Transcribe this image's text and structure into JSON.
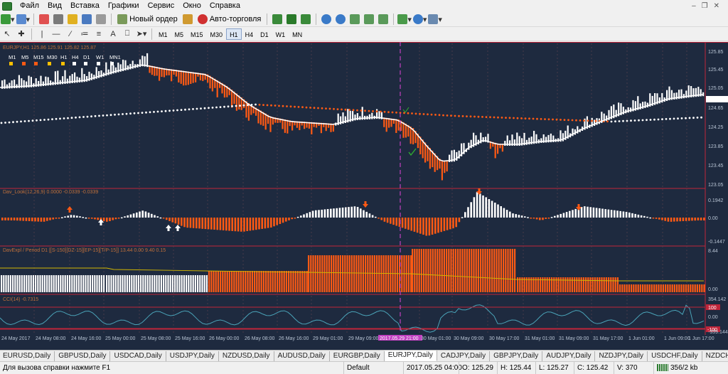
{
  "menu": [
    "Файл",
    "Вид",
    "Вставка",
    "Графики",
    "Сервис",
    "Окно",
    "Справка"
  ],
  "toolbar": {
    "new_order_label": "Новый ордер",
    "auto_trading_label": "Авто-торговля",
    "draw_text_tool": "A",
    "timeframes": [
      "M1",
      "M5",
      "M15",
      "M30",
      "H1",
      "H4",
      "D1",
      "W1",
      "MN"
    ],
    "active_timeframe": "H1"
  },
  "chart": {
    "main_title": "EURJPY,H1  125.86 125.91 125.82 125.87",
    "mtf_labels": [
      "M1",
      "M5",
      "M15",
      "M30",
      "H1",
      "H4",
      "D1",
      "W1",
      "MN1"
    ],
    "mtf_colors": [
      "#ffc000",
      "#ff5a14",
      "#ff5a14",
      "#ffc000",
      "#ffc000",
      "#ffffff",
      "#ffffff",
      "#ffffff",
      "#ffffff"
    ],
    "price_axis": [
      "125.85",
      "125.45",
      "125.05",
      "124.65",
      "124.25",
      "123.85",
      "123.45",
      "123.05"
    ],
    "indicator1_title": "Dav_Look(12,26,9)  0.0000 -0.0339 -0.0339",
    "indicator1_axis": [
      "0.1942",
      "0.00",
      "-0.1447"
    ],
    "indicator2_title": "DavExpl / Period D1  [[S-150][DZ-15][EP-15][T/P-15]]  13.44  0.00  9.40  0.15",
    "indicator2_axis": [
      "8.44",
      "0.00"
    ],
    "cci_title": "CCI(14) -0.7315",
    "cci_axis": [
      "354.142",
      "100",
      "0.00",
      "-100",
      "-339.144"
    ],
    "time_axis": [
      "24 May 2017",
      "24 May 08:00",
      "24 May 16:00",
      "25 May 00:00",
      "25 May 08:00",
      "25 May 16:00",
      "26 May 00:00",
      "26 May 08:00",
      "26 May 16:00",
      "29 May 01:00",
      "29 May 09:00",
      "2017.05.29 21:00",
      "30 May 01:00",
      "30 May 09:00",
      "30 May 17:00",
      "31 May 01:00",
      "31 May 09:00",
      "31 May 17:00",
      "1 Jun 01:00",
      "1 Jun 09:00",
      "1 Jun 17:00"
    ],
    "crosshair_time": "2017.05.29 21:00",
    "colors": {
      "background": "#1e2a3f",
      "bull": "#ffffff",
      "bear": "#ff5a14",
      "ma_fast": "#ffffff",
      "ma_slow_dots_bull": "#ffffff",
      "ma_slow_dots_bear": "#ff5a14",
      "crosshair": "#c040c0",
      "separator": "#c0253a",
      "cci_line": "#4aa3b8"
    }
  },
  "tabs": [
    "EURUSD,Daily",
    "GBPUSD,Daily",
    "USDCAD,Daily",
    "USDJPY,Daily",
    "NZDUSD,Daily",
    "AUDUSD,Daily",
    "EURGBP,Daily",
    "EURJPY,Daily",
    "CADJPY,Daily",
    "GBPJPY,Daily",
    "AUDJPY,Daily",
    "NZDJPY,Daily",
    "USDCHF,Daily",
    "NZDCHF,Dai"
  ],
  "active_tab": "EURJPY,Daily",
  "status": {
    "help": "Для вызова справки нажмите F1",
    "profile": "Default",
    "datetime": "2017.05.25 04:00",
    "open": "O: 125.29",
    "high": "H: 125.44",
    "low": "L: 125.27",
    "close": "C: 125.42",
    "volume": "V: 370",
    "traffic": "356/2 kb"
  }
}
